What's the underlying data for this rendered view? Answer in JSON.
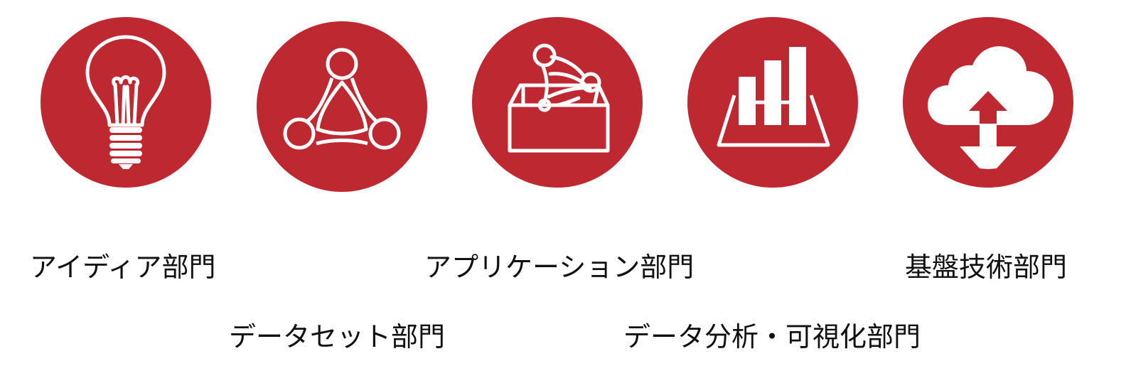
{
  "accent_color": "#bd2831",
  "icon_color": "#ffffff",
  "categories": [
    {
      "label": "アイディア部門",
      "icon": "lightbulb-icon"
    },
    {
      "label": "データセット部門",
      "icon": "dataset-network-icon"
    },
    {
      "label": "アプリケーション部門",
      "icon": "application-box-icon"
    },
    {
      "label": "データ分析・可視化部門",
      "icon": "bar-chart-icon"
    },
    {
      "label": "基盤技術部門",
      "icon": "cloud-upload-download-icon"
    }
  ]
}
